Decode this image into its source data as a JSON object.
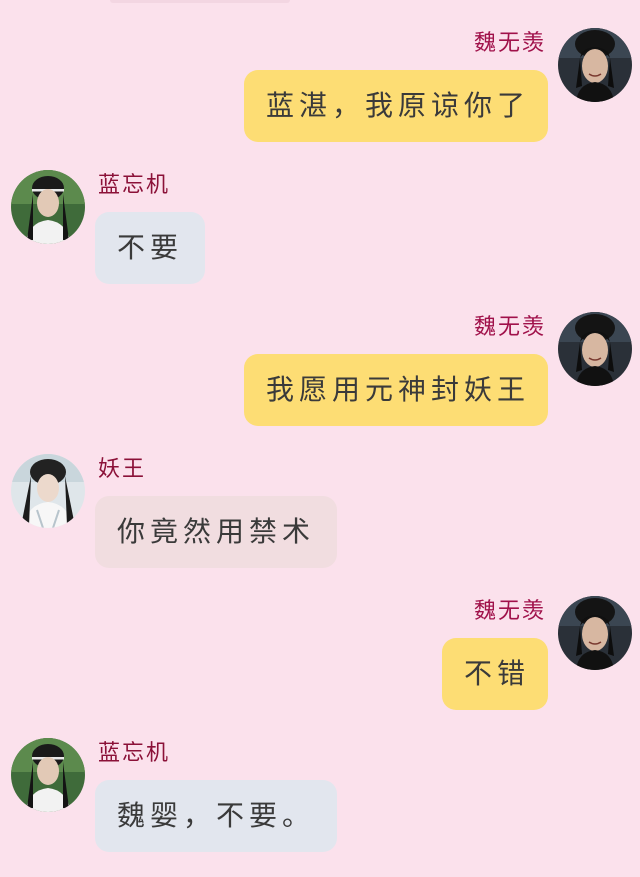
{
  "colors": {
    "background": "#fbe1ec",
    "bubble_wei": "#fddd74",
    "bubble_lan": "#e2e6ee",
    "bubble_yaowang": "#f1dde0",
    "name_wei": "#a0114a",
    "name_other": "#8b1138",
    "text": "#3a3a3a"
  },
  "messages": [
    {
      "sender": "魏无羡",
      "side": "right",
      "text": "蓝湛，我原谅你了",
      "avatar": "wei-wuxian-avatar"
    },
    {
      "sender": "蓝忘机",
      "side": "left",
      "text": "不要",
      "avatar": "lan-wangji-avatar"
    },
    {
      "sender": "魏无羡",
      "side": "right",
      "text": "我愿用元神封妖王",
      "avatar": "wei-wuxian-avatar"
    },
    {
      "sender": "妖王",
      "side": "left",
      "text": "你竟然用禁术",
      "avatar": "yaowang-avatar"
    },
    {
      "sender": "魏无羡",
      "side": "right",
      "text": "不错",
      "avatar": "wei-wuxian-avatar"
    },
    {
      "sender": "蓝忘机",
      "side": "left",
      "text": "魏婴，不要。",
      "avatar": "lan-wangji-avatar"
    }
  ]
}
